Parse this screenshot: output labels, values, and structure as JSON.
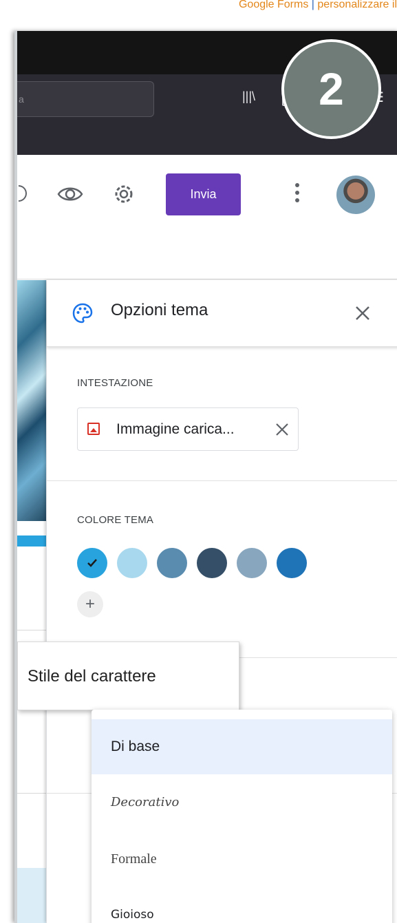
{
  "caption": {
    "left": "Google Forms",
    "separator": " | ",
    "right": "personalizzare il"
  },
  "browser": {
    "url_fragment": "a",
    "badge_number": "2"
  },
  "toolbar": {
    "send_label": "Invia"
  },
  "theme_panel": {
    "title": "Opzioni tema",
    "header_section_label": "INTESTAZIONE",
    "uploaded_image_label": "Immagine carica...",
    "color_section_label": "COLORE TEMA",
    "add_color_label": "+",
    "theme_colors": [
      "#29a3de",
      "#a8d8ee",
      "#5a8cb0",
      "#344f67",
      "#88a7bf",
      "#1f73b7"
    ],
    "selected_color_index": 0
  },
  "tooltip": {
    "text": "Stile del carattere"
  },
  "font_dropdown": {
    "options": [
      "Di base",
      "Decorativo",
      "Formale",
      "Gioioso"
    ],
    "selected_index": 0
  }
}
